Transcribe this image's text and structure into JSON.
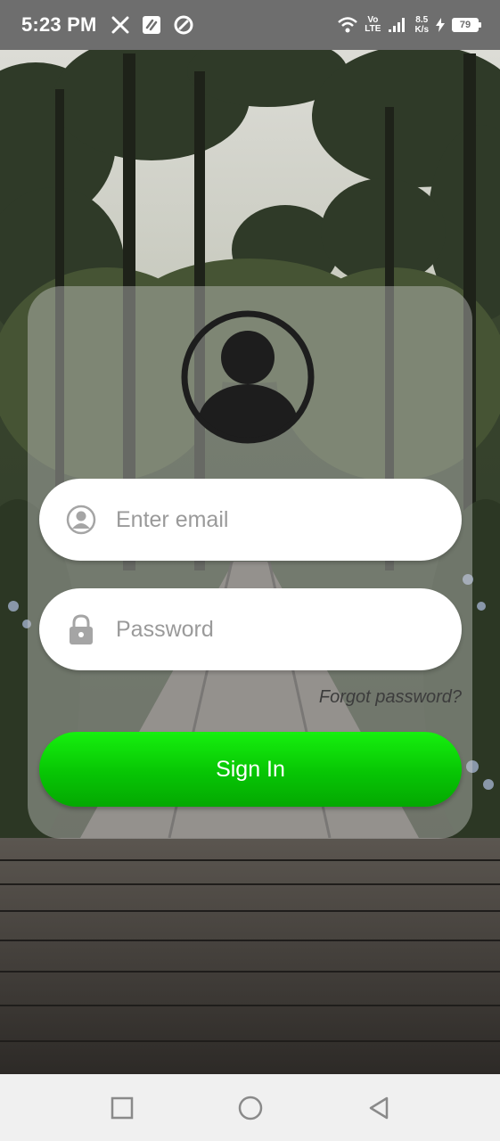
{
  "status_bar": {
    "time": "5:23 PM",
    "left_icons": [
      "x-logo-icon",
      "notes-app-icon",
      "sync-app-icon"
    ],
    "network_label_top": "Vo",
    "network_label_bottom": "LTE",
    "speed_value": "8.5",
    "speed_unit": "K/s",
    "battery_level": "79",
    "charging": true
  },
  "login": {
    "email_placeholder": "Enter email",
    "password_placeholder": "Password",
    "forgot_label": "Forgot password?",
    "signin_label": "Sign In"
  },
  "colors": {
    "signin_green": "#07c504",
    "card_overlay": "#cdcdcd",
    "status_bar": "#6e6e6e",
    "nav_bar": "#f0f0f0"
  },
  "nav_bar": {
    "buttons": [
      "recents-square-icon",
      "home-circle-icon",
      "back-triangle-icon"
    ]
  }
}
